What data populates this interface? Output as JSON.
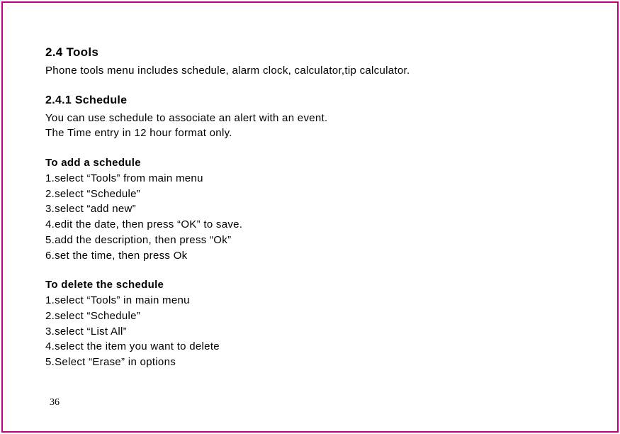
{
  "section": {
    "heading": "2.4 Tools",
    "intro": "Phone tools menu includes   schedule, alarm clock, calculator,tip calculator."
  },
  "subsection": {
    "heading": "2.4.1 Schedule",
    "line1": "You can use schedule to associate an alert with an event.",
    "line2": "The Time entry in 12 hour format only."
  },
  "addSchedule": {
    "title": "To add a schedule",
    "steps": {
      "s1": "1.select “Tools” from main menu",
      "s2": "2.select “Schedule”",
      "s3": "3.select “add new”",
      "s4": "4.edit the date, then press “OK” to save.",
      "s5": "5.add the description, then press “Ok”",
      "s6": "6.set the time, then press Ok"
    }
  },
  "deleteSchedule": {
    "title": "To delete the schedule",
    "steps": {
      "s1": "1.select “Tools” in main menu",
      "s2": "2.select “Schedule”",
      "s3": "3.select “List All”",
      "s4": "4.select the item you want to delete",
      "s5": "5.Select “Erase” in options"
    }
  },
  "pageNumber": "36"
}
